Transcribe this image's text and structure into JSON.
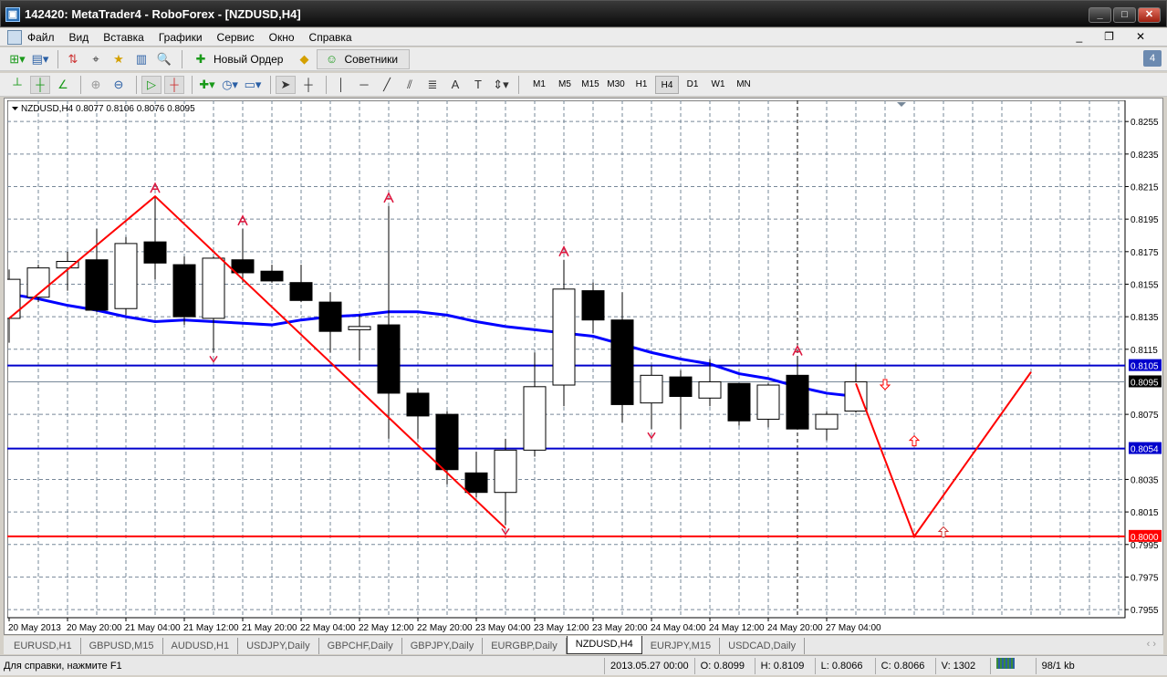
{
  "window": {
    "title": "142420: MetaTrader4 - RoboForex - [NZDUSD,H4]",
    "min": "_",
    "max": "□",
    "close": "✕"
  },
  "menu": [
    "Файл",
    "Вид",
    "Вставка",
    "Графики",
    "Сервис",
    "Окно",
    "Справка"
  ],
  "mdi": {
    "min": "_",
    "restore": "❐",
    "close": "✕"
  },
  "toolbar1": {
    "new_order": "Новый Ордер",
    "experts": "Советники",
    "badge": "4"
  },
  "timeframes": [
    "M1",
    "M5",
    "M15",
    "M30",
    "H1",
    "H4",
    "D1",
    "W1",
    "MN"
  ],
  "active_timeframe": "H4",
  "chart_header": "NZDUSD,H4  0.8077 0.8106 0.8076 0.8095",
  "colors": {
    "bull": "#ffffff",
    "bear": "#000000",
    "ma": "#0000ff",
    "zigzag": "#ff0000",
    "grid": "#778899",
    "fractal": "#dc143c"
  },
  "chart_data": {
    "type": "candlestick",
    "symbol": "NZDUSD",
    "timeframe": "H4",
    "ylim": [
      0.795,
      0.8268
    ],
    "y_ticks": [
      "0.8255",
      "0.8235",
      "0.8215",
      "0.8195",
      "0.8175",
      "0.8155",
      "0.8135",
      "0.8115",
      "0.8075",
      "0.8035",
      "0.8015",
      "0.7995",
      "0.7975",
      "0.7955"
    ],
    "x_labels": [
      "20 May 2013",
      "20 May 20:00",
      "21 May 04:00",
      "21 May 12:00",
      "21 May 20:00",
      "22 May 04:00",
      "22 May 12:00",
      "22 May 20:00",
      "23 May 04:00",
      "23 May 12:00",
      "23 May 20:00",
      "24 May 04:00",
      "24 May 12:00",
      "24 May 20:00",
      "27 May 04:00"
    ],
    "ohlc": [
      [
        0.8134,
        0.8164,
        0.8119,
        0.8158
      ],
      [
        0.8147,
        0.8167,
        0.8144,
        0.8165
      ],
      [
        0.8165,
        0.8175,
        0.8151,
        0.8169
      ],
      [
        0.817,
        0.8189,
        0.8138,
        0.8139
      ],
      [
        0.814,
        0.8184,
        0.8136,
        0.818
      ],
      [
        0.8181,
        0.8209,
        0.8158,
        0.8168
      ],
      [
        0.8167,
        0.8172,
        0.813,
        0.8135
      ],
      [
        0.8134,
        0.8172,
        0.8113,
        0.8171
      ],
      [
        0.817,
        0.8189,
        0.8156,
        0.8162
      ],
      [
        0.8163,
        0.8167,
        0.8156,
        0.8157
      ],
      [
        0.8156,
        0.8167,
        0.8144,
        0.8145
      ],
      [
        0.8144,
        0.815,
        0.8113,
        0.8126
      ],
      [
        0.8127,
        0.8136,
        0.8108,
        0.8129
      ],
      [
        0.813,
        0.8203,
        0.806,
        0.8088
      ],
      [
        0.8088,
        0.8091,
        0.806,
        0.8074
      ],
      [
        0.8075,
        0.8077,
        0.8032,
        0.8041
      ],
      [
        0.8039,
        0.8052,
        0.8024,
        0.8027
      ],
      [
        0.8027,
        0.806,
        0.8007,
        0.8053
      ],
      [
        0.8053,
        0.8113,
        0.8049,
        0.8092
      ],
      [
        0.8093,
        0.817,
        0.808,
        0.8152
      ],
      [
        0.8151,
        0.8156,
        0.8125,
        0.8133
      ],
      [
        0.8133,
        0.815,
        0.807,
        0.8081
      ],
      [
        0.8082,
        0.8105,
        0.8066,
        0.8099
      ],
      [
        0.8098,
        0.8102,
        0.8066,
        0.8086
      ],
      [
        0.8085,
        0.8109,
        0.808,
        0.8095
      ],
      [
        0.8094,
        0.8094,
        0.8068,
        0.8071
      ],
      [
        0.8072,
        0.8094,
        0.8067,
        0.8093
      ],
      [
        0.8099,
        0.8109,
        0.8066,
        0.8066
      ],
      [
        0.8066,
        0.8077,
        0.8059,
        0.8075
      ],
      [
        0.8077,
        0.8106,
        0.8076,
        0.8095
      ]
    ],
    "ma": [
      0.8149,
      0.8146,
      0.8142,
      0.8139,
      0.8135,
      0.8132,
      0.8133,
      0.8132,
      0.8131,
      0.813,
      0.8133,
      0.8135,
      0.8136,
      0.8138,
      0.8138,
      0.8136,
      0.8132,
      0.8129,
      0.8127,
      0.8125,
      0.8123,
      0.8118,
      0.8113,
      0.8109,
      0.8106,
      0.81,
      0.8097,
      0.8092,
      0.8088,
      0.8086
    ],
    "zigzag": [
      [
        0,
        0.8134
      ],
      [
        5,
        0.8209
      ],
      [
        17,
        0.8005
      ]
    ],
    "projection": [
      [
        29,
        0.8094
      ],
      [
        31,
        0.8
      ],
      [
        35,
        0.8101
      ]
    ],
    "fractals_up": [
      [
        5,
        0.8209
      ],
      [
        8,
        0.8189
      ],
      [
        13,
        0.8203
      ],
      [
        19,
        0.817
      ],
      [
        27,
        0.8109
      ]
    ],
    "fractals_down": [
      [
        7,
        0.8113
      ],
      [
        17,
        0.8007
      ],
      [
        22,
        0.8066
      ]
    ],
    "signal_arrows": [
      {
        "bar": 30,
        "price": 0.8093,
        "dir": "down"
      },
      {
        "bar": 31,
        "price": 0.8059,
        "dir": "up"
      },
      {
        "bar": 32,
        "price": 0.8003,
        "dir": "up"
      }
    ],
    "hlines": [
      {
        "price": 0.8105,
        "label": "0.8105",
        "color": "#0000cc"
      },
      {
        "price": 0.8054,
        "label": "0.8054",
        "color": "#0000cc"
      },
      {
        "price": 0.8,
        "label": "0.8000",
        "color": "#ff0000"
      }
    ],
    "bid": {
      "price": 0.8095,
      "label": "0.8095"
    },
    "vline_bar": 27
  },
  "tabs": [
    "EURUSD,H1",
    "GBPUSD,M15",
    "AUDUSD,H1",
    "USDJPY,Daily",
    "GBPCHF,Daily",
    "GBPJPY,Daily",
    "EURGBP,Daily",
    "NZDUSD,H4",
    "EURJPY,M15",
    "USDCAD,Daily"
  ],
  "active_tab": "NZDUSD,H4",
  "tab_nav": "‹ ›",
  "status": {
    "help": "Для справки, нажмите F1",
    "time": "2013.05.27 00:00",
    "open": "O: 0.8099",
    "high": "H: 0.8109",
    "low": "L: 0.8066",
    "close": "C: 0.8066",
    "volume": "V: 1302",
    "traffic": "98/1 kb"
  }
}
